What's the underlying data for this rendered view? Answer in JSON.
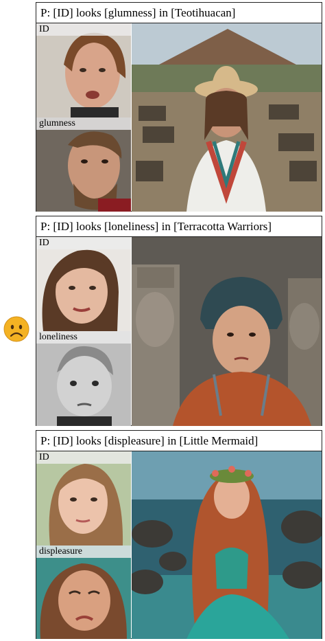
{
  "panels": [
    {
      "caption": "P: [ID] looks [glumness]  in [Teotihuacan]",
      "id_label": "ID",
      "emotion_label": "glumness",
      "colors": {
        "sky": "#b9c9d4",
        "ground": "#8a7a62",
        "accent": "#d8c08a"
      }
    },
    {
      "caption": "P: [ID] looks [loneliness]  in [Terracotta Warriors]",
      "id_label": "ID",
      "emotion_label": "loneliness",
      "colors": {
        "sky": "#6e6c66",
        "ground": "#5a4b3c",
        "accent": "#c0532b"
      }
    },
    {
      "caption": "P: [ID] looks [displeasure]  in [Little Mermaid]",
      "id_label": "ID",
      "emotion_label": "displeasure",
      "colors": {
        "sky": "#5a8fa3",
        "ground": "#2f5d6b",
        "accent": "#c96a3d"
      }
    }
  ],
  "emoji": {
    "icon": "sad-face-icon",
    "color": "#f4b223"
  }
}
